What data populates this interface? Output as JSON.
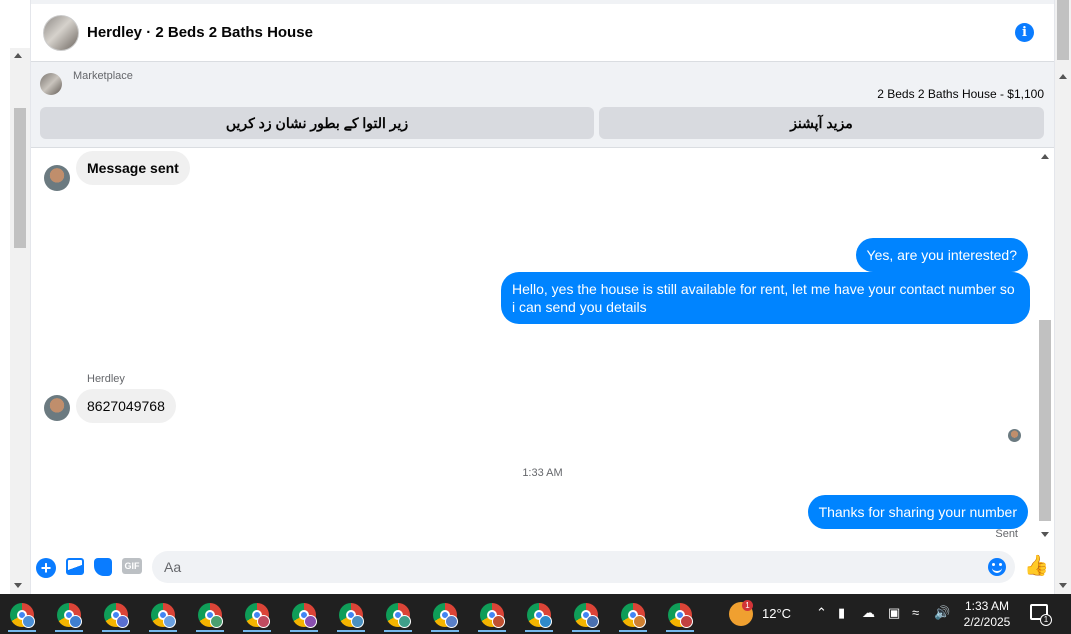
{
  "header": {
    "title": "Herdley · 2 Beds 2 Baths House",
    "info_icon": "info-icon"
  },
  "marketplace": {
    "label": "Marketplace",
    "listing": "2 Beds 2 Baths House - $1,100",
    "buttons": {
      "left": "زیر التوا کے بطور نشان زد کریں",
      "right": "مزید آپشنز"
    }
  },
  "messages": [
    {
      "direction": "in",
      "text": "Message sent"
    },
    {
      "direction": "out",
      "text": "Yes, are you interested?"
    },
    {
      "direction": "out",
      "text": "Hello, yes the house is still available for rent, let me have your contact number so i can send you details"
    },
    {
      "direction": "in",
      "sender": "Herdley",
      "text": "8627049768"
    },
    {
      "direction": "out",
      "text": "Thanks for sharing your number"
    }
  ],
  "timestamp": "1:33 AM",
  "sent_status": "Sent",
  "composer": {
    "placeholder": "Aa",
    "icons": [
      "plus-icon",
      "photo-icon",
      "sticker-icon",
      "gif-icon",
      "emoji-icon",
      "like-icon"
    ],
    "gif_label": "GIF",
    "accent_color": "#0084ff"
  },
  "taskbar": {
    "apps": [
      "chrome-profile-1",
      "chrome-profile-2",
      "chrome-profile-3",
      "chrome-profile-4",
      "chrome-profile-5",
      "chrome-profile-6",
      "chrome-profile-7",
      "chrome-profile-8",
      "chrome-profile-9",
      "chrome-profile-10",
      "chrome-profile-11",
      "chrome-profile-12",
      "chrome-profile-13",
      "chrome-profile-14",
      "chrome-profile-15"
    ],
    "weather_badge": "1",
    "temperature": "12°C",
    "time": "1:33 AM",
    "date": "2/2/2025",
    "notification_count": "1"
  }
}
